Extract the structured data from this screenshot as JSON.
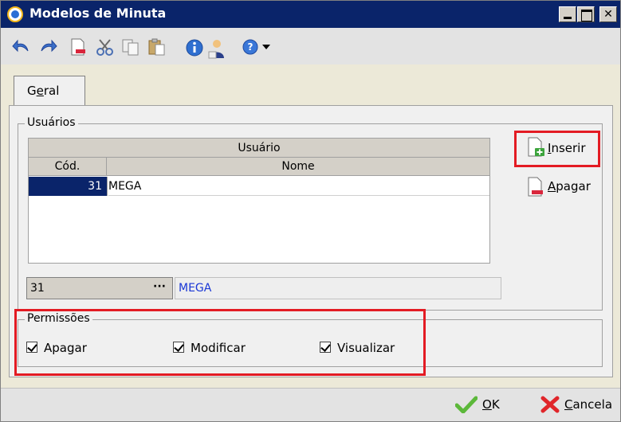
{
  "window": {
    "title": "Modelos de Minuta",
    "title_icon": "app-icon"
  },
  "toolbar": {
    "icons": [
      "undo-icon",
      "redo-icon",
      "new-document-icon",
      "cut-icon",
      "copy-icon",
      "paste-icon",
      "info-icon",
      "user-icon",
      "help-icon",
      "dropdown-arrow-icon"
    ]
  },
  "tabs": [
    {
      "label_pre": "G",
      "label_accel": "e",
      "label_post": "ral"
    }
  ],
  "users_group": {
    "label": "Usuários",
    "grid": {
      "band_header": "Usuário",
      "columns": [
        "Cód.",
        "Nome"
      ],
      "rows": [
        {
          "cod": "31",
          "nome": "MEGA"
        }
      ]
    },
    "lookup": {
      "code": "31",
      "dots": "···",
      "name": "MEGA"
    },
    "buttons": {
      "inserir": {
        "accel": "I",
        "rest": "nserir"
      },
      "apagar": {
        "accel": "A",
        "rest": "pagar"
      }
    }
  },
  "permissions_group": {
    "label": "Permissões",
    "checks": [
      {
        "label": "Apagar",
        "checked": true
      },
      {
        "label": "Modificar",
        "checked": true
      },
      {
        "label": "Visualizar",
        "checked": true
      }
    ]
  },
  "footer": {
    "ok": {
      "accel": "O",
      "rest": "K"
    },
    "cancel": {
      "accel": "C",
      "rest": "ancela"
    }
  },
  "colors": {
    "highlight": "#e31b23",
    "selection": "#0a246a",
    "lookup_text": "#1a37d6"
  }
}
